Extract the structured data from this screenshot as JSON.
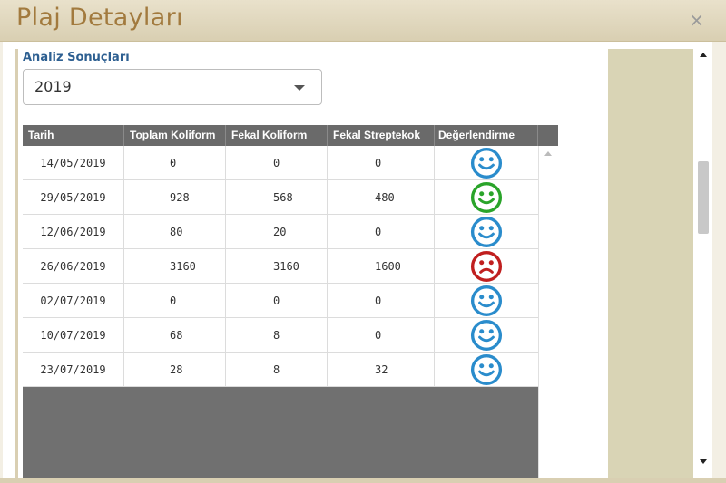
{
  "dialog": {
    "title": "Plaj Detayları",
    "close_symbol": "×"
  },
  "analysis": {
    "label": "Analiz Sonuçları",
    "year_selected": "2019"
  },
  "table": {
    "columns": [
      "Tarih",
      "Toplam Koliform",
      "Fekal Koliform",
      "Fekal Streptekok",
      "Değerlendirme"
    ],
    "rows": [
      {
        "date": "14/05/2019",
        "toplam": "0",
        "fekal_koliform": "0",
        "fekal_streptekok": "0",
        "rating": "good"
      },
      {
        "date": "29/05/2019",
        "toplam": "928",
        "fekal_koliform": "568",
        "fekal_streptekok": "480",
        "rating": "ok"
      },
      {
        "date": "12/06/2019",
        "toplam": "80",
        "fekal_koliform": "20",
        "fekal_streptekok": "0",
        "rating": "good"
      },
      {
        "date": "26/06/2019",
        "toplam": "3160",
        "fekal_koliform": "3160",
        "fekal_streptekok": "1600",
        "rating": "bad"
      },
      {
        "date": "02/07/2019",
        "toplam": "0",
        "fekal_koliform": "0",
        "fekal_streptekok": "0",
        "rating": "good"
      },
      {
        "date": "10/07/2019",
        "toplam": "68",
        "fekal_koliform": "8",
        "fekal_streptekok": "0",
        "rating": "good"
      },
      {
        "date": "23/07/2019",
        "toplam": "28",
        "fekal_koliform": "8",
        "fekal_streptekok": "32",
        "rating": "good"
      }
    ]
  },
  "rating_colors": {
    "good": "#2a8ccc",
    "ok": "#2aa42a",
    "bad": "#c01f1f"
  },
  "rating_icons": {
    "good": "smiley-happy-icon",
    "ok": "smiley-happy-icon",
    "bad": "smiley-sad-icon"
  }
}
